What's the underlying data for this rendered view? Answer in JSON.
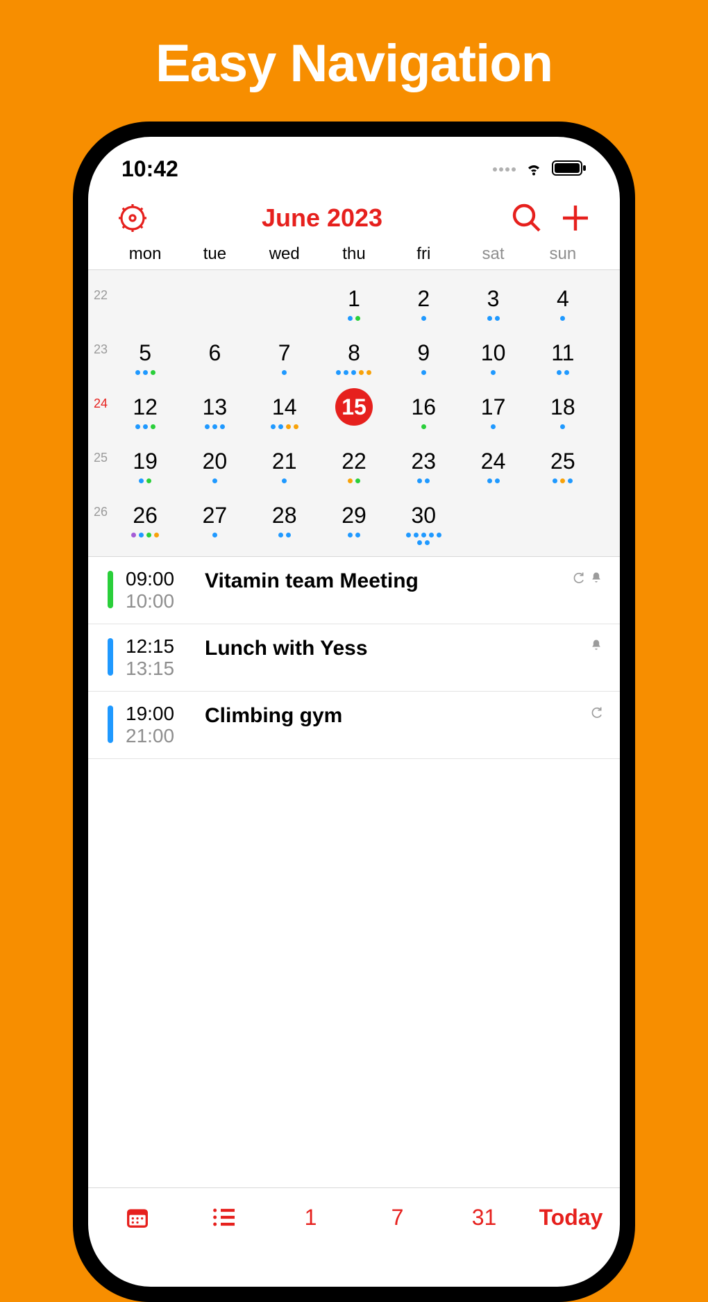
{
  "hero": {
    "title": "Easy Navigation"
  },
  "statusbar": {
    "time": "10:42"
  },
  "navbar": {
    "title": "June 2023"
  },
  "weekdays": [
    "mon",
    "tue",
    "wed",
    "thu",
    "fri",
    "sat",
    "sun"
  ],
  "calendar": {
    "weeks": [
      {
        "num": "22",
        "current": false,
        "days": [
          {
            "n": "",
            "dots": []
          },
          {
            "n": "",
            "dots": []
          },
          {
            "n": "",
            "dots": []
          },
          {
            "n": "1",
            "dots": [
              "blue",
              "green"
            ]
          },
          {
            "n": "2",
            "dots": [
              "blue"
            ]
          },
          {
            "n": "3",
            "dots": [
              "blue",
              "blue"
            ]
          },
          {
            "n": "4",
            "dots": [
              "blue"
            ]
          }
        ]
      },
      {
        "num": "23",
        "current": false,
        "days": [
          {
            "n": "5",
            "dots": [
              "blue",
              "blue",
              "green"
            ]
          },
          {
            "n": "6",
            "dots": []
          },
          {
            "n": "7",
            "dots": [
              "blue"
            ]
          },
          {
            "n": "8",
            "dots": [
              "blue",
              "blue",
              "blue",
              "orange",
              "orange"
            ]
          },
          {
            "n": "9",
            "dots": [
              "blue"
            ]
          },
          {
            "n": "10",
            "dots": [
              "blue"
            ]
          },
          {
            "n": "11",
            "dots": [
              "blue",
              "blue"
            ]
          }
        ]
      },
      {
        "num": "24",
        "current": true,
        "days": [
          {
            "n": "12",
            "dots": [
              "blue",
              "blue",
              "green"
            ]
          },
          {
            "n": "13",
            "dots": [
              "blue",
              "blue",
              "blue"
            ]
          },
          {
            "n": "14",
            "dots": [
              "blue",
              "blue",
              "orange",
              "orange"
            ]
          },
          {
            "n": "15",
            "selected": true,
            "dots": []
          },
          {
            "n": "16",
            "dots": [
              "green"
            ]
          },
          {
            "n": "17",
            "dots": [
              "blue"
            ]
          },
          {
            "n": "18",
            "dots": [
              "blue"
            ]
          }
        ]
      },
      {
        "num": "25",
        "current": false,
        "days": [
          {
            "n": "19",
            "dots": [
              "blue",
              "green"
            ]
          },
          {
            "n": "20",
            "dots": [
              "blue"
            ]
          },
          {
            "n": "21",
            "dots": [
              "blue"
            ]
          },
          {
            "n": "22",
            "dots": [
              "orange",
              "green"
            ]
          },
          {
            "n": "23",
            "dots": [
              "blue",
              "blue"
            ]
          },
          {
            "n": "24",
            "dots": [
              "blue",
              "blue"
            ]
          },
          {
            "n": "25",
            "dots": [
              "blue",
              "orange",
              "blue"
            ]
          }
        ]
      },
      {
        "num": "26",
        "current": false,
        "days": [
          {
            "n": "26",
            "dots": [
              "purple",
              "blue",
              "green",
              "orange"
            ]
          },
          {
            "n": "27",
            "dots": [
              "blue"
            ]
          },
          {
            "n": "28",
            "dots": [
              "blue",
              "blue"
            ]
          },
          {
            "n": "29",
            "dots": [
              "blue",
              "blue"
            ]
          },
          {
            "n": "30",
            "dots": [
              "blue",
              "blue",
              "blue",
              "blue",
              "blue",
              "blue",
              "blue"
            ]
          },
          {
            "n": "",
            "dots": []
          },
          {
            "n": "",
            "dots": []
          }
        ]
      }
    ]
  },
  "events": [
    {
      "color": "#2acf3a",
      "start": "09:00",
      "end": "10:00",
      "title": "Vitamin team Meeting",
      "repeat": true,
      "alarm": true
    },
    {
      "color": "#1f99ff",
      "start": "12:15",
      "end": "13:15",
      "title": "Lunch with Yess",
      "repeat": false,
      "alarm": true
    },
    {
      "color": "#1f99ff",
      "start": "19:00",
      "end": "21:00",
      "title": "Climbing gym",
      "repeat": true,
      "alarm": false
    }
  ],
  "tabbar": {
    "day_label": "1",
    "week_label": "7",
    "month_label": "31",
    "today_label": "Today"
  }
}
